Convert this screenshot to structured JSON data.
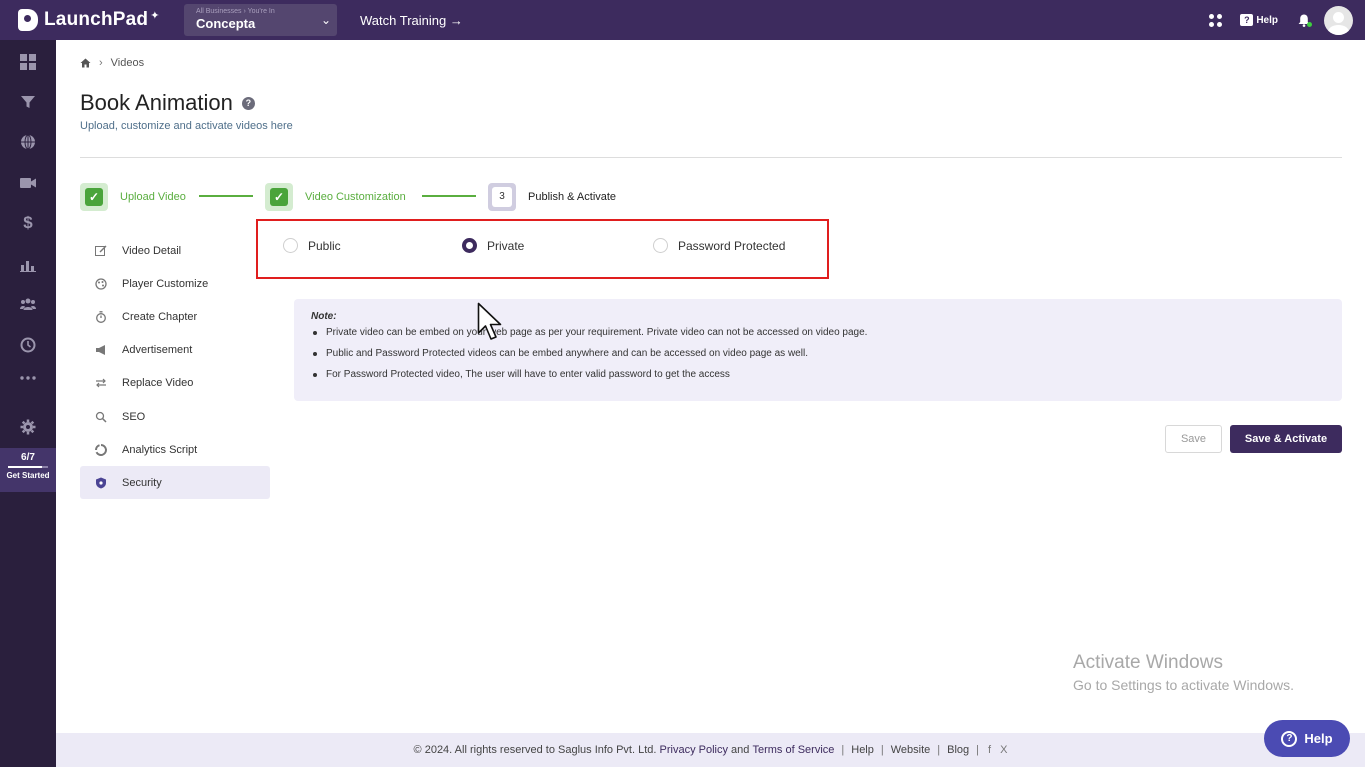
{
  "topbar": {
    "app_name": "LaunchPad",
    "business_small": "All Businesses › You're In",
    "business_name": "Concepta",
    "watch_training": "Watch Training →",
    "help_label": "Help"
  },
  "rail": {
    "icons": [
      "dashboard-icon",
      "funnel-icon",
      "globe-icon",
      "video-icon",
      "dollar-icon",
      "chart-icon",
      "users-icon",
      "clock-icon",
      "more-icon",
      "settings-icon"
    ],
    "get_started_count": "6/7",
    "get_started_label": "Get Started"
  },
  "breadcrumb": {
    "current": "Videos"
  },
  "page": {
    "title": "Book Animation",
    "subtitle": "Upload, customize and activate videos here"
  },
  "stepper": [
    {
      "label": "Upload Video",
      "state": "done"
    },
    {
      "label": "Video Customization",
      "state": "done"
    },
    {
      "number": "3",
      "label": "Publish & Activate",
      "state": "current"
    }
  ],
  "menu": [
    {
      "label": "Video Detail",
      "icon": "edit-icon"
    },
    {
      "label": "Player Customize",
      "icon": "palette-icon"
    },
    {
      "label": "Create Chapter",
      "icon": "timer-icon"
    },
    {
      "label": "Advertisement",
      "icon": "megaphone-icon"
    },
    {
      "label": "Replace Video",
      "icon": "swap-icon"
    },
    {
      "label": "SEO",
      "icon": "search-icon"
    },
    {
      "label": "Analytics Script",
      "icon": "analytics-icon"
    },
    {
      "label": "Security",
      "icon": "shield-icon",
      "active": true
    }
  ],
  "privacy": {
    "options": [
      "Public",
      "Private",
      "Password Protected"
    ],
    "selected": "Private"
  },
  "note": {
    "title": "Note:",
    "items": [
      "Private video can be embed on your web page as per your requirement. Private video can not be accessed on video page.",
      "Public and Password Protected videos can be embed anywhere and can be accessed on video page as well.",
      "For Password Protected video, The user will have to enter valid password to get the access"
    ]
  },
  "actions": {
    "save": "Save",
    "save_activate": "Save & Activate"
  },
  "watermark": {
    "line1": "Activate Windows",
    "line2": "Go to Settings to activate Windows."
  },
  "footer": {
    "copyright": "© 2024. All rights reserved to Saglus Info Pvt. Ltd.",
    "privacy": "Privacy Policy",
    "and": "and",
    "terms": "Terms of Service",
    "help": "Help",
    "website": "Website",
    "blog": "Blog",
    "social": [
      "f",
      "X"
    ]
  },
  "help_button": "Help",
  "colors": {
    "brand": "#3d2b5e",
    "success": "#5aae3f",
    "highlight_border": "#e01e1e",
    "note_bg": "#f0eef9"
  }
}
